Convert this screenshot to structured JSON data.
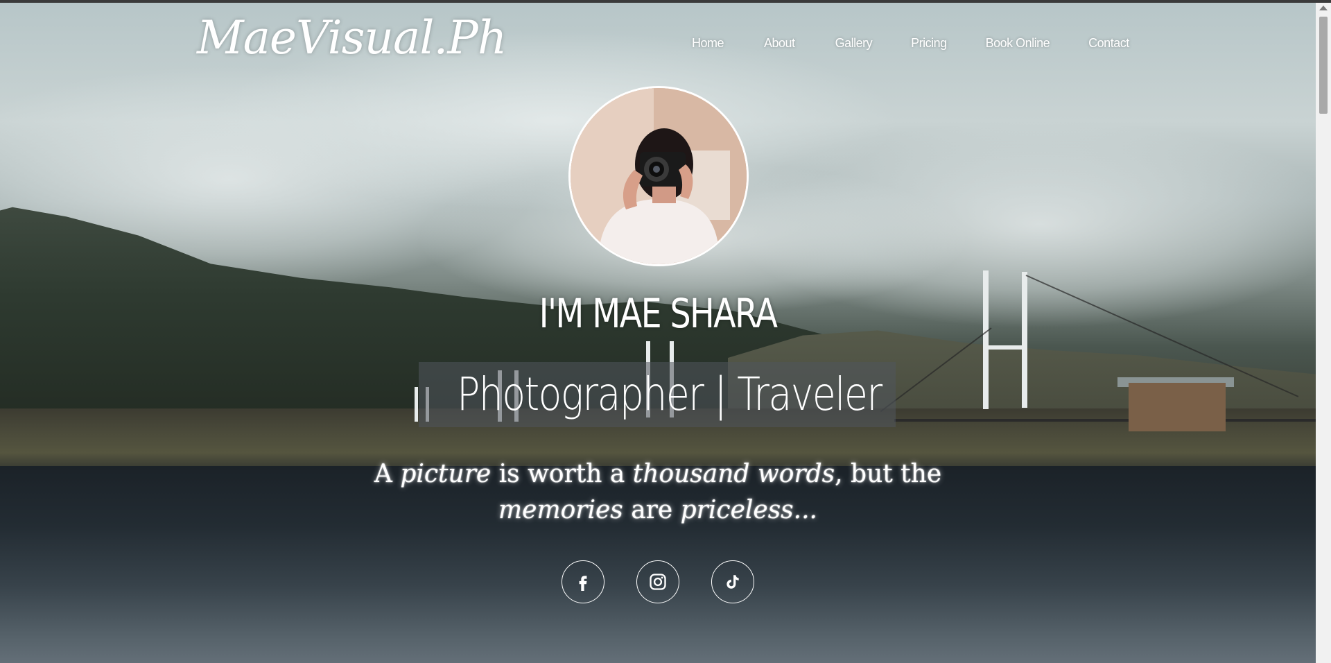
{
  "header": {
    "logo": "MaeVisual.Ph",
    "nav": [
      {
        "label": "Home"
      },
      {
        "label": "About"
      },
      {
        "label": "Gallery"
      },
      {
        "label": "Pricing"
      },
      {
        "label": "Book Online"
      },
      {
        "label": "Contact"
      }
    ]
  },
  "hero": {
    "name": "I'M MAE SHARA",
    "tagline": "Photographer | Traveler",
    "quote": {
      "part1": "A ",
      "em1": "picture",
      "part2": " is worth a ",
      "em2": "thousand words",
      "part3": ", but the",
      "em3": "memories",
      "part4": " are ",
      "em4": "priceless..."
    },
    "avatar_alt": "photographer-portrait"
  },
  "socials": [
    {
      "name": "facebook-icon"
    },
    {
      "name": "instagram-icon"
    },
    {
      "name": "tiktok-icon"
    }
  ],
  "colors": {
    "text": "#ffffff",
    "tagline_box": "#50565c"
  }
}
